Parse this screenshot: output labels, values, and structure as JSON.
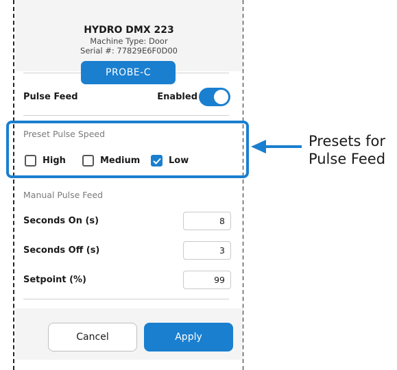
{
  "machine": {
    "name": "HYDRO DMX 223",
    "type": "Machine Type: Door",
    "serial": "Serial #: 77829E6F0D00"
  },
  "probe_tab": {
    "label": "PROBE-C"
  },
  "pulse_feed": {
    "label": "Pulse Feed",
    "status": "Enabled",
    "enabled": true
  },
  "preset": {
    "title": "Preset Pulse Speed",
    "options": [
      {
        "label": "High",
        "checked": false
      },
      {
        "label": "Medium",
        "checked": false
      },
      {
        "label": "Low",
        "checked": true
      }
    ]
  },
  "manual": {
    "title": "Manual Pulse Feed",
    "fields": [
      {
        "label": "Seconds On (s)",
        "value": "8"
      },
      {
        "label": "Seconds Off (s)",
        "value": "3"
      },
      {
        "label": "Setpoint (%)",
        "value": "99"
      }
    ]
  },
  "buttons": {
    "cancel": "Cancel",
    "apply": "Apply"
  },
  "annotation": {
    "line1": "Presets for",
    "line2": "Pulse Feed"
  },
  "colors": {
    "accent": "#1a7fcf",
    "header_bg": "#f4f4f4"
  }
}
